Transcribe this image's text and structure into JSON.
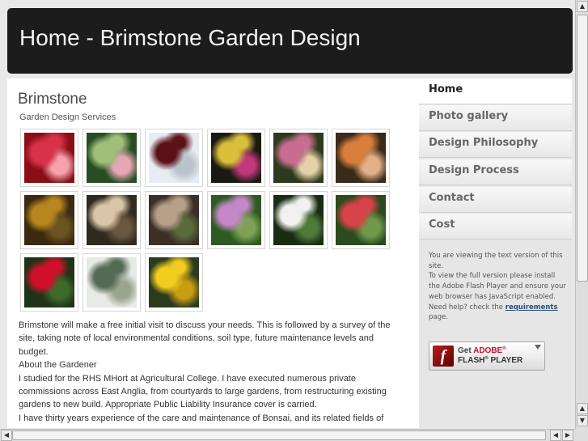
{
  "header": {
    "title": "Home - Brimstone Garden Design"
  },
  "main": {
    "heading": "Brimstone",
    "subtitle": "Garden Design Services",
    "gallery": [
      {
        "icon": "photo-red-leaves",
        "colors": [
          "#8a0e16",
          "#d8324a",
          "#f4a3ad"
        ]
      },
      {
        "icon": "photo-green-pink-leaves",
        "colors": [
          "#284d22",
          "#9fbf7a",
          "#e7a6b8"
        ]
      },
      {
        "icon": "photo-dark-leaves-sky",
        "colors": [
          "#e8ecf2",
          "#5a1218",
          "#b9c3cc"
        ]
      },
      {
        "icon": "photo-autumn-leaf",
        "colors": [
          "#1b1a12",
          "#d9c03a",
          "#c0377b"
        ]
      },
      {
        "icon": "photo-pink-foliage",
        "colors": [
          "#2d3a1e",
          "#c86d8f",
          "#e5d2a8"
        ]
      },
      {
        "icon": "photo-orange-foliage",
        "colors": [
          "#3b2a1a",
          "#d97e3d",
          "#e4b08b"
        ]
      },
      {
        "icon": "photo-autumn-tree",
        "colors": [
          "#3b2a0f",
          "#b8861f",
          "#6b5421"
        ]
      },
      {
        "icon": "photo-mushrooms",
        "colors": [
          "#2f2a1f",
          "#d9c6a8",
          "#6a5740"
        ]
      },
      {
        "icon": "photo-ground-cover",
        "colors": [
          "#3b2f26",
          "#b7a08a",
          "#5a6a3a"
        ]
      },
      {
        "icon": "photo-pink-flowers",
        "colors": [
          "#2f5a22",
          "#c487c8",
          "#7fa055"
        ]
      },
      {
        "icon": "photo-white-flowers",
        "colors": [
          "#1a2d14",
          "#f1f1ee",
          "#4f7a3a"
        ]
      },
      {
        "icon": "photo-red-poppy",
        "colors": [
          "#2b4a1e",
          "#d8434a",
          "#6f9a4a"
        ]
      },
      {
        "icon": "photo-red-flower",
        "colors": [
          "#1f3318",
          "#d0102b",
          "#3d6a2a"
        ]
      },
      {
        "icon": "photo-frosty-branches",
        "colors": [
          "#e8eae6",
          "#556a55",
          "#9aa58f"
        ]
      },
      {
        "icon": "photo-yellow-flowers",
        "colors": [
          "#2a3b1e",
          "#f1cd1f",
          "#c79d12"
        ]
      }
    ],
    "paragraphs": [
      "Brimstone will make a free initial visit to discuss your needs. This is followed by a survey of the site, taking note of local environmental conditions, soil type, future maintenance levels and budget.",
      "About the Gardener",
      "I studied for the RHS MHort at Agricultural College. I have executed numerous private commissions across East Anglia, from courtyards to large gardens, from restructuring existing gardens to new build. Appropriate Public Liability Insurance cover is carried.",
      "I have thirty years experience of the care and maintenance of Bonsai, and its related fields of"
    ]
  },
  "sidebar": {
    "nav": [
      {
        "label": "Home",
        "active": true
      },
      {
        "label": "Photo gallery",
        "active": false
      },
      {
        "label": "Design Philosophy",
        "active": false
      },
      {
        "label": "Design Process",
        "active": false
      },
      {
        "label": "Contact",
        "active": false
      },
      {
        "label": "Cost",
        "active": false
      }
    ],
    "note": {
      "line1": "You are viewing the text version of this site.",
      "line2": "To view the full version please install the Adobe Flash Player and ensure your web browser has JavaScript enabled.",
      "help_prefix": "Need help? check the",
      "help_link": "requirements",
      "help_suffix": "page."
    },
    "flash_button": {
      "get": "Get",
      "adobe": "ADOBE",
      "product": "FLASH",
      "player": "PLAYER",
      "logo_letter": "f"
    }
  },
  "scrollbars": {
    "up": "▲",
    "down": "▼",
    "left": "◀",
    "right": "▶"
  }
}
